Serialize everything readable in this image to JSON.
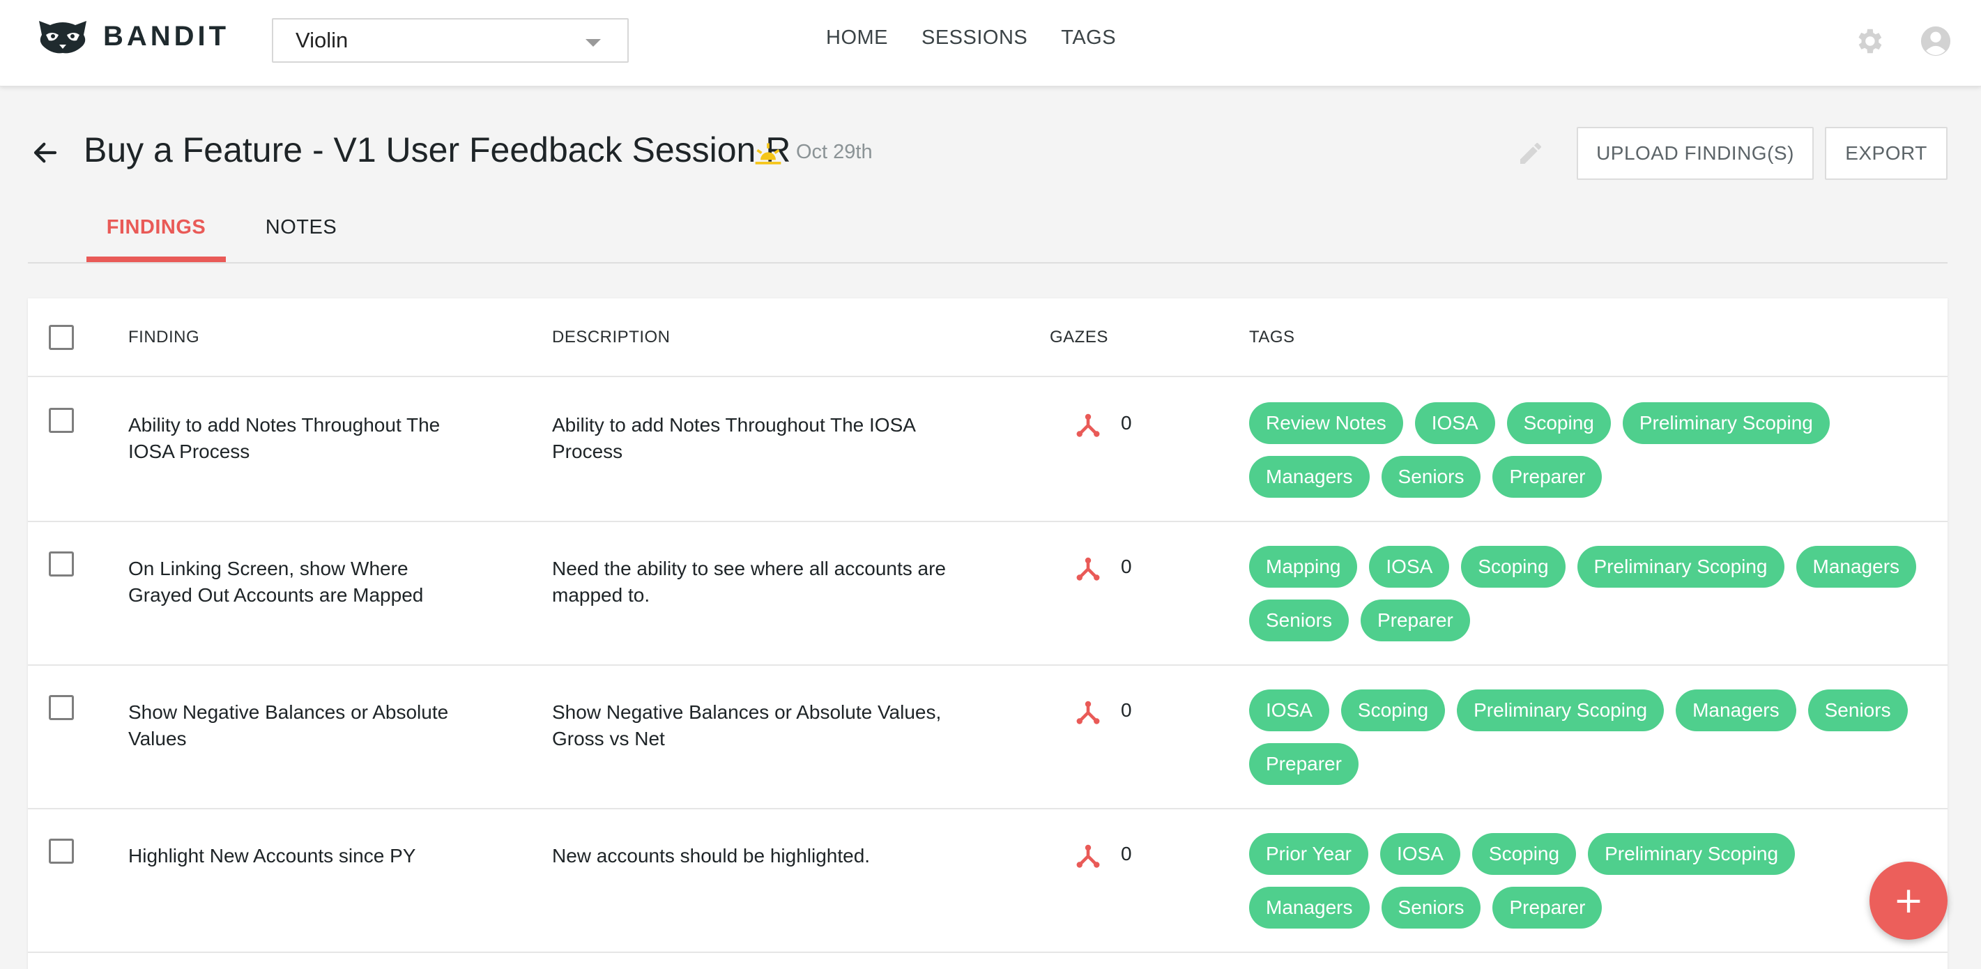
{
  "app": {
    "logo_text": "BANDIT"
  },
  "project_select": {
    "value": "Violin"
  },
  "nav": {
    "items": [
      "HOME",
      "SESSIONS",
      "TAGS"
    ]
  },
  "header_icons": {
    "settings": "gear-icon",
    "user": "user-circle-icon"
  },
  "session": {
    "title": "Buy a Feature - V1 User Feedback Session R",
    "weather_icon": "sun-horizon-icon",
    "date": "Oct 29th",
    "upload_label": "UPLOAD FINDING(S)",
    "export_label": "EXPORT"
  },
  "tabs": [
    {
      "label": "FINDINGS",
      "active": true
    },
    {
      "label": "NOTES",
      "active": false
    }
  ],
  "table": {
    "columns": {
      "finding": "FINDING",
      "description": "DESCRIPTION",
      "gazes": "GAZES",
      "tags": "TAGS"
    },
    "rows": [
      {
        "finding": "Ability to add Notes Throughout The IOSA Process",
        "description": "Ability to add Notes Throughout The IOSA Process",
        "gazes": "0",
        "tags": [
          "Review Notes",
          "IOSA",
          "Scoping",
          "Preliminary Scoping",
          "Managers",
          "Seniors",
          "Preparer"
        ]
      },
      {
        "finding": "On Linking Screen, show Where Grayed Out Accounts are Mapped",
        "description": "Need the ability to see where all accounts are mapped to.",
        "gazes": "0",
        "tags": [
          "Mapping",
          "IOSA",
          "Scoping",
          "Preliminary Scoping",
          "Managers",
          "Seniors",
          "Preparer"
        ]
      },
      {
        "finding": "Show Negative Balances or Absolute Values",
        "description": "Show Negative Balances or Absolute Values, Gross vs Net",
        "gazes": "0",
        "tags": [
          "IOSA",
          "Scoping",
          "Preliminary Scoping",
          "Managers",
          "Seniors",
          "Preparer"
        ]
      },
      {
        "finding": "Highlight New Accounts since PY",
        "description": "New accounts should be highlighted.",
        "gazes": "0",
        "tags": [
          "Prior Year",
          "IOSA",
          "Scoping",
          "Preliminary Scoping",
          "Managers",
          "Seniors",
          "Preparer"
        ]
      }
    ]
  },
  "fab": {
    "label": "+"
  },
  "colors": {
    "accent": "#e95a57",
    "tag": "#4fcf8d",
    "fab": "#ec5f5b"
  }
}
